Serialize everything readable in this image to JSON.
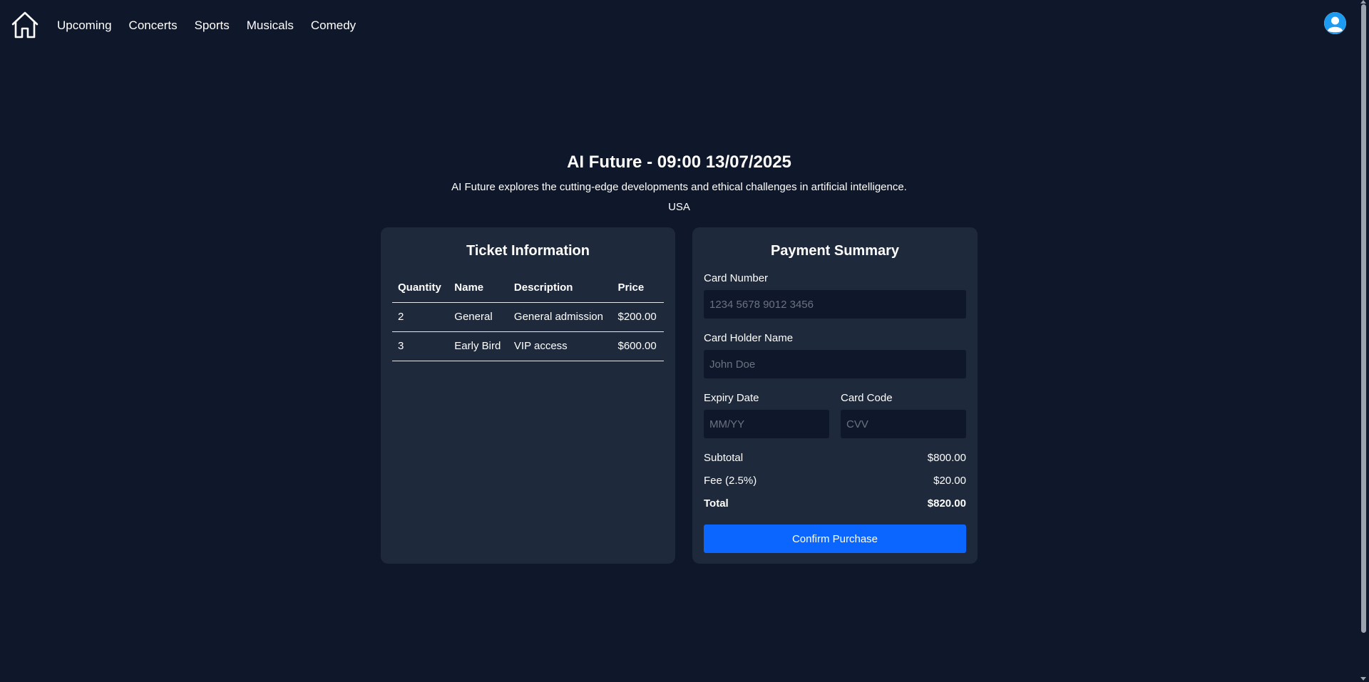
{
  "nav": {
    "home_icon": "home-icon",
    "links": [
      "Upcoming",
      "Concerts",
      "Sports",
      "Musicals",
      "Comedy"
    ],
    "avatar_icon": "user-avatar-icon"
  },
  "event": {
    "title": "AI Future - 09:00 13/07/2025",
    "description": "AI Future explores the cutting-edge developments and ethical challenges in artificial intelligence.",
    "location": "USA"
  },
  "tickets": {
    "title": "Ticket Information",
    "headers": [
      "Quantity",
      "Name",
      "Description",
      "Price"
    ],
    "rows": [
      [
        "2",
        "General",
        "General admission",
        "$200.00"
      ],
      [
        "3",
        "Early Bird",
        "VIP access",
        "$600.00"
      ]
    ]
  },
  "payment": {
    "title": "Payment Summary",
    "card_number_label": "Card Number",
    "card_number_placeholder": "1234 5678 9012 3456",
    "card_holder_label": "Card Holder Name",
    "card_holder_placeholder": "John Doe",
    "expiry_label": "Expiry Date",
    "expiry_placeholder": "MM/YY",
    "code_label": "Card Code",
    "code_placeholder": "CVV",
    "subtotal_label": "Subtotal",
    "subtotal_value": "$800.00",
    "fee_label": "Fee (2.5%)",
    "fee_value": "$20.00",
    "total_label": "Total",
    "total_value": "$820.00",
    "confirm_label": "Confirm Purchase"
  },
  "colors": {
    "background": "#0f172a",
    "card": "#1e293b",
    "accent": "#0a66ff"
  }
}
